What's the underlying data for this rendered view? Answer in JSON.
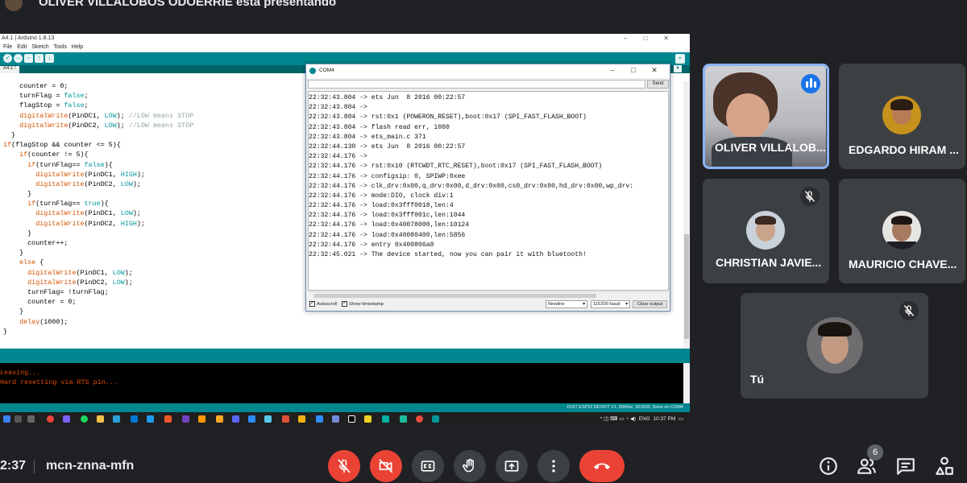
{
  "presenter": {
    "text": "OLIVER VILLALOBOS ODOERRIE está presentando"
  },
  "arduino": {
    "window_title": "A4.1 | Arduino 1.8.13",
    "menu": [
      "File",
      "Edit",
      "Sketch",
      "Tools",
      "Help"
    ],
    "tab": "A4.1",
    "code_lines": [
      [
        {
          "t": "    counter = 0;"
        }
      ],
      [
        {
          "t": "    turnFlag = "
        },
        {
          "t": "false",
          "c": "ty"
        },
        {
          "t": ";"
        }
      ],
      [
        {
          "t": "    flagStop = "
        },
        {
          "t": "false",
          "c": "ty"
        },
        {
          "t": ";"
        }
      ],
      [
        {
          "t": "    "
        },
        {
          "t": "digitalWrite",
          "c": "kw"
        },
        {
          "t": "(PinDC1, "
        },
        {
          "t": "LOW",
          "c": "ct"
        },
        {
          "t": "); "
        },
        {
          "t": "//LOW means STOP",
          "c": "cm"
        }
      ],
      [
        {
          "t": "    "
        },
        {
          "t": "digitalWrite",
          "c": "kw"
        },
        {
          "t": "(PinDC2, "
        },
        {
          "t": "LOW",
          "c": "ct"
        },
        {
          "t": "); "
        },
        {
          "t": "//LOW means STOP",
          "c": "cm"
        }
      ],
      [
        {
          "t": "  }"
        }
      ],
      [
        {
          "t": "if",
          "c": "kw"
        },
        {
          "t": "(flagStop && counter <= 5){"
        }
      ],
      [
        {
          "t": "    "
        },
        {
          "t": "if",
          "c": "kw"
        },
        {
          "t": "(counter != 5){"
        }
      ],
      [
        {
          "t": "      "
        },
        {
          "t": "if",
          "c": "kw"
        },
        {
          "t": "(turnFlag== "
        },
        {
          "t": "false",
          "c": "ty"
        },
        {
          "t": "){"
        }
      ],
      [
        {
          "t": "        "
        },
        {
          "t": "digitalWrite",
          "c": "kw"
        },
        {
          "t": "(PinDC1, "
        },
        {
          "t": "HIGH",
          "c": "ct"
        },
        {
          "t": ");"
        }
      ],
      [
        {
          "t": "        "
        },
        {
          "t": "digitalWrite",
          "c": "kw"
        },
        {
          "t": "(PinDC2, "
        },
        {
          "t": "LOW",
          "c": "ct"
        },
        {
          "t": ");"
        }
      ],
      [
        {
          "t": "      }"
        }
      ],
      [
        {
          "t": "      "
        },
        {
          "t": "if",
          "c": "kw"
        },
        {
          "t": "(turnFlag== "
        },
        {
          "t": "true",
          "c": "ty"
        },
        {
          "t": "){"
        }
      ],
      [
        {
          "t": "        "
        },
        {
          "t": "digitalWrite",
          "c": "kw"
        },
        {
          "t": "(PinDC1, "
        },
        {
          "t": "LOW",
          "c": "ct"
        },
        {
          "t": ");"
        }
      ],
      [
        {
          "t": "        "
        },
        {
          "t": "digitalWrite",
          "c": "kw"
        },
        {
          "t": "(PinDC2, "
        },
        {
          "t": "HIGH",
          "c": "ct"
        },
        {
          "t": ");"
        }
      ],
      [
        {
          "t": "      }"
        }
      ],
      [
        {
          "t": "      counter++;"
        }
      ],
      [
        {
          "t": "    }"
        }
      ],
      [
        {
          "t": "    "
        },
        {
          "t": "else",
          "c": "kw"
        },
        {
          "t": " {"
        }
      ],
      [
        {
          "t": "      "
        },
        {
          "t": "digitalWrite",
          "c": "kw"
        },
        {
          "t": "(PinDC1, "
        },
        {
          "t": "LOW",
          "c": "ct"
        },
        {
          "t": ");"
        }
      ],
      [
        {
          "t": "      "
        },
        {
          "t": "digitalWrite",
          "c": "kw"
        },
        {
          "t": "(PinDC2, "
        },
        {
          "t": "LOW",
          "c": "ct"
        },
        {
          "t": ");"
        }
      ],
      [
        {
          "t": "      turnFlag= !turnFlag;"
        }
      ],
      [
        {
          "t": "      counter = 0;"
        }
      ],
      [
        {
          "t": "    }"
        }
      ],
      [
        {
          "t": "    "
        },
        {
          "t": "delay",
          "c": "kw"
        },
        {
          "t": "(1000);"
        }
      ],
      [
        {
          "t": "}"
        }
      ]
    ],
    "console_lines": [
      "Leaving...",
      "Hard resetting via RTS pin..."
    ],
    "board_info": "DOIT ESP32 DEVKIT V1, 80MHz, 921600, None en COM4"
  },
  "serial_monitor": {
    "title": "COM4",
    "send_label": "Send",
    "input_value": "",
    "output_lines": [
      "22:32:43.804 -> ets Jun  8 2016 00:22:57",
      "22:32:43.804 ->",
      "22:32:43.804 -> rst:0x1 (POWERON_RESET),boot:0x17 (SPI_FAST_FLASH_BOOT)",
      "22:32:43.804 -> flash read err, 1000",
      "22:32:43.804 -> ets_main.c 371",
      "22:32:44.130 -> ets Jun  8 2016 00:22:57",
      "22:32:44.176 ->",
      "22:32:44.176 -> rst:0x10 (RTCWDT_RTC_RESET),boot:0x17 (SPI_FAST_FLASH_BOOT)",
      "22:32:44.176 -> configsip: 0, SPIWP:0xee",
      "22:32:44.176 -> clk_drv:0x00,q_drv:0x00,d_drv:0x00,cs0_drv:0x00,hd_drv:0x00,wp_drv:",
      "22:32:44.176 -> mode:DIO, clock div:1",
      "22:32:44.176 -> load:0x3fff0018,len:4",
      "22:32:44.176 -> load:0x3fff001c,len:1044",
      "22:32:44.176 -> load:0x40078000,len:10124",
      "22:32:44.176 -> load:0x40080400,len:5856",
      "22:32:44.176 -> entry 0x400806a8",
      "22:32:45.021 -> The device started, now you can pair it with bluetooth!"
    ],
    "autoscroll_label": "Autoscroll",
    "timestamp_label": "Show timestamp",
    "line_ending": "Newline",
    "baud": "115200 baud",
    "clear_label": "Clear output"
  },
  "taskbar": {
    "lang": "ENG",
    "time": "10:37 PM"
  },
  "participants": [
    {
      "name": "OLIVER VILLALOB...",
      "speaking": true
    },
    {
      "name": "EDGARDO HIRAM ...",
      "muted": false
    },
    {
      "name": "CHRISTIAN JAVIE...",
      "muted": true
    },
    {
      "name": "MAURICIO CHAVE...",
      "muted": false
    },
    {
      "name": "Tú",
      "muted": true
    }
  ],
  "meeting": {
    "clock": "2:37",
    "code": "mcn-znna-mfn",
    "people_count": "6"
  },
  "colors": {
    "arduino_teal": "#00878f",
    "meet_red": "#ea4335",
    "active_blue": "#8ab4f8"
  }
}
